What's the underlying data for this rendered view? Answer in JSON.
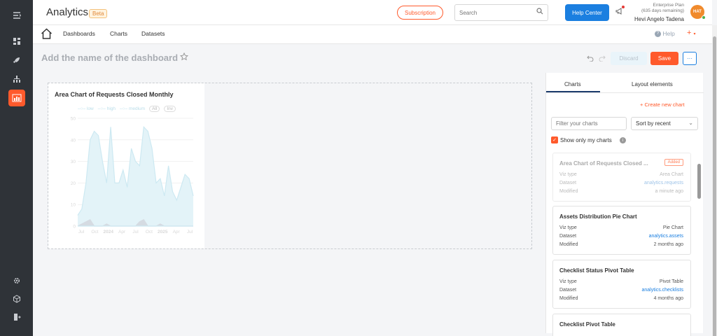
{
  "app": {
    "title": "Analytics",
    "badge": "Beta"
  },
  "header": {
    "subscription_label": "Subscription",
    "search_placeholder": "Search",
    "help_center_label": "Help Center",
    "plan_line1": "Enterprise Plan",
    "plan_line2": "(635 days remaining)",
    "user_name": "Hevi Angelo Tadena",
    "avatar_initials": "HAT"
  },
  "nav": {
    "links": [
      "Dashboards",
      "Charts",
      "Datasets"
    ],
    "help_label": "Help",
    "plus_label": "+"
  },
  "dashboard": {
    "title_placeholder": "Add the name of the dashboard",
    "discard_label": "Discard",
    "save_label": "Save",
    "more_label": "···"
  },
  "widget": {
    "title": "Area Chart of Requests Closed Monthly",
    "legend": [
      "low",
      "high",
      "medium"
    ],
    "legend_pills": [
      "All",
      "Inv"
    ]
  },
  "chart_data": {
    "type": "area",
    "title": "Area Chart of Requests Closed Monthly",
    "ylim": [
      0,
      50
    ],
    "yticks": [
      "50",
      "40",
      "30",
      "20",
      "10",
      "0"
    ],
    "xticks": [
      "Jul",
      "Oct",
      "2024",
      "Apr",
      "Jul",
      "Oct",
      "2025",
      "Apr",
      "Jul"
    ],
    "series": [
      {
        "name": "low",
        "values": [
          5,
          8,
          20,
          40,
          44,
          42,
          30,
          20,
          46,
          20,
          20,
          26,
          18,
          36,
          30,
          28,
          46,
          44,
          36,
          20,
          22,
          14,
          28,
          16,
          12,
          18,
          24,
          22,
          14
        ]
      },
      {
        "name": "high",
        "values": [
          0,
          1,
          2,
          3,
          0,
          0,
          0,
          1,
          0,
          0,
          0,
          0,
          0,
          0,
          0,
          2,
          3,
          0,
          0,
          0,
          1,
          0,
          0,
          0,
          0,
          0,
          0,
          0,
          0
        ]
      },
      {
        "name": "medium",
        "values": [
          0,
          0,
          0,
          0,
          0,
          0,
          0,
          0,
          0,
          0,
          0,
          0,
          0,
          0,
          0,
          0,
          0,
          0,
          0,
          0,
          0,
          0,
          0,
          0,
          0,
          0,
          0,
          0,
          0
        ]
      }
    ],
    "colors": {
      "low": "#e3f3f8",
      "low_line": "#cde9f2",
      "high": "#d5dbe2",
      "grid": "#f1f1f1",
      "tick": "#d8d8d8"
    }
  },
  "panel": {
    "tabs": [
      "Charts",
      "Layout elements"
    ],
    "create_new_label": "+    Create new chart",
    "filter_placeholder": "Filter your charts",
    "sort_value": "Sort by recent",
    "show_only_mine_label": "Show only my charts",
    "cards": [
      {
        "title": "Area Chart of Requests Closed ...",
        "badge": "Added",
        "rows": [
          {
            "key": "Viz type",
            "value": "Area Chart"
          },
          {
            "key": "Dataset",
            "value": "analytics.requests"
          },
          {
            "key": "Modified",
            "value": "a minute ago"
          }
        ]
      },
      {
        "title": "Assets Distribution Pie Chart",
        "rows": [
          {
            "key": "Viz type",
            "value": "Pie Chart"
          },
          {
            "key": "Dataset",
            "value": "analytics.assets"
          },
          {
            "key": "Modified",
            "value": "2 months ago"
          }
        ]
      },
      {
        "title": "Checklist Status Pivot Table",
        "rows": [
          {
            "key": "Viz type",
            "value": "Pivot Table"
          },
          {
            "key": "Dataset",
            "value": "analytics.checklists"
          },
          {
            "key": "Modified",
            "value": "4 months ago"
          }
        ]
      },
      {
        "title": "Checklist Pivot Table",
        "rows": []
      }
    ]
  },
  "colors": {
    "accent": "#ff5a2c",
    "primary": "#1b7fe0",
    "rail": "#2f3338"
  }
}
